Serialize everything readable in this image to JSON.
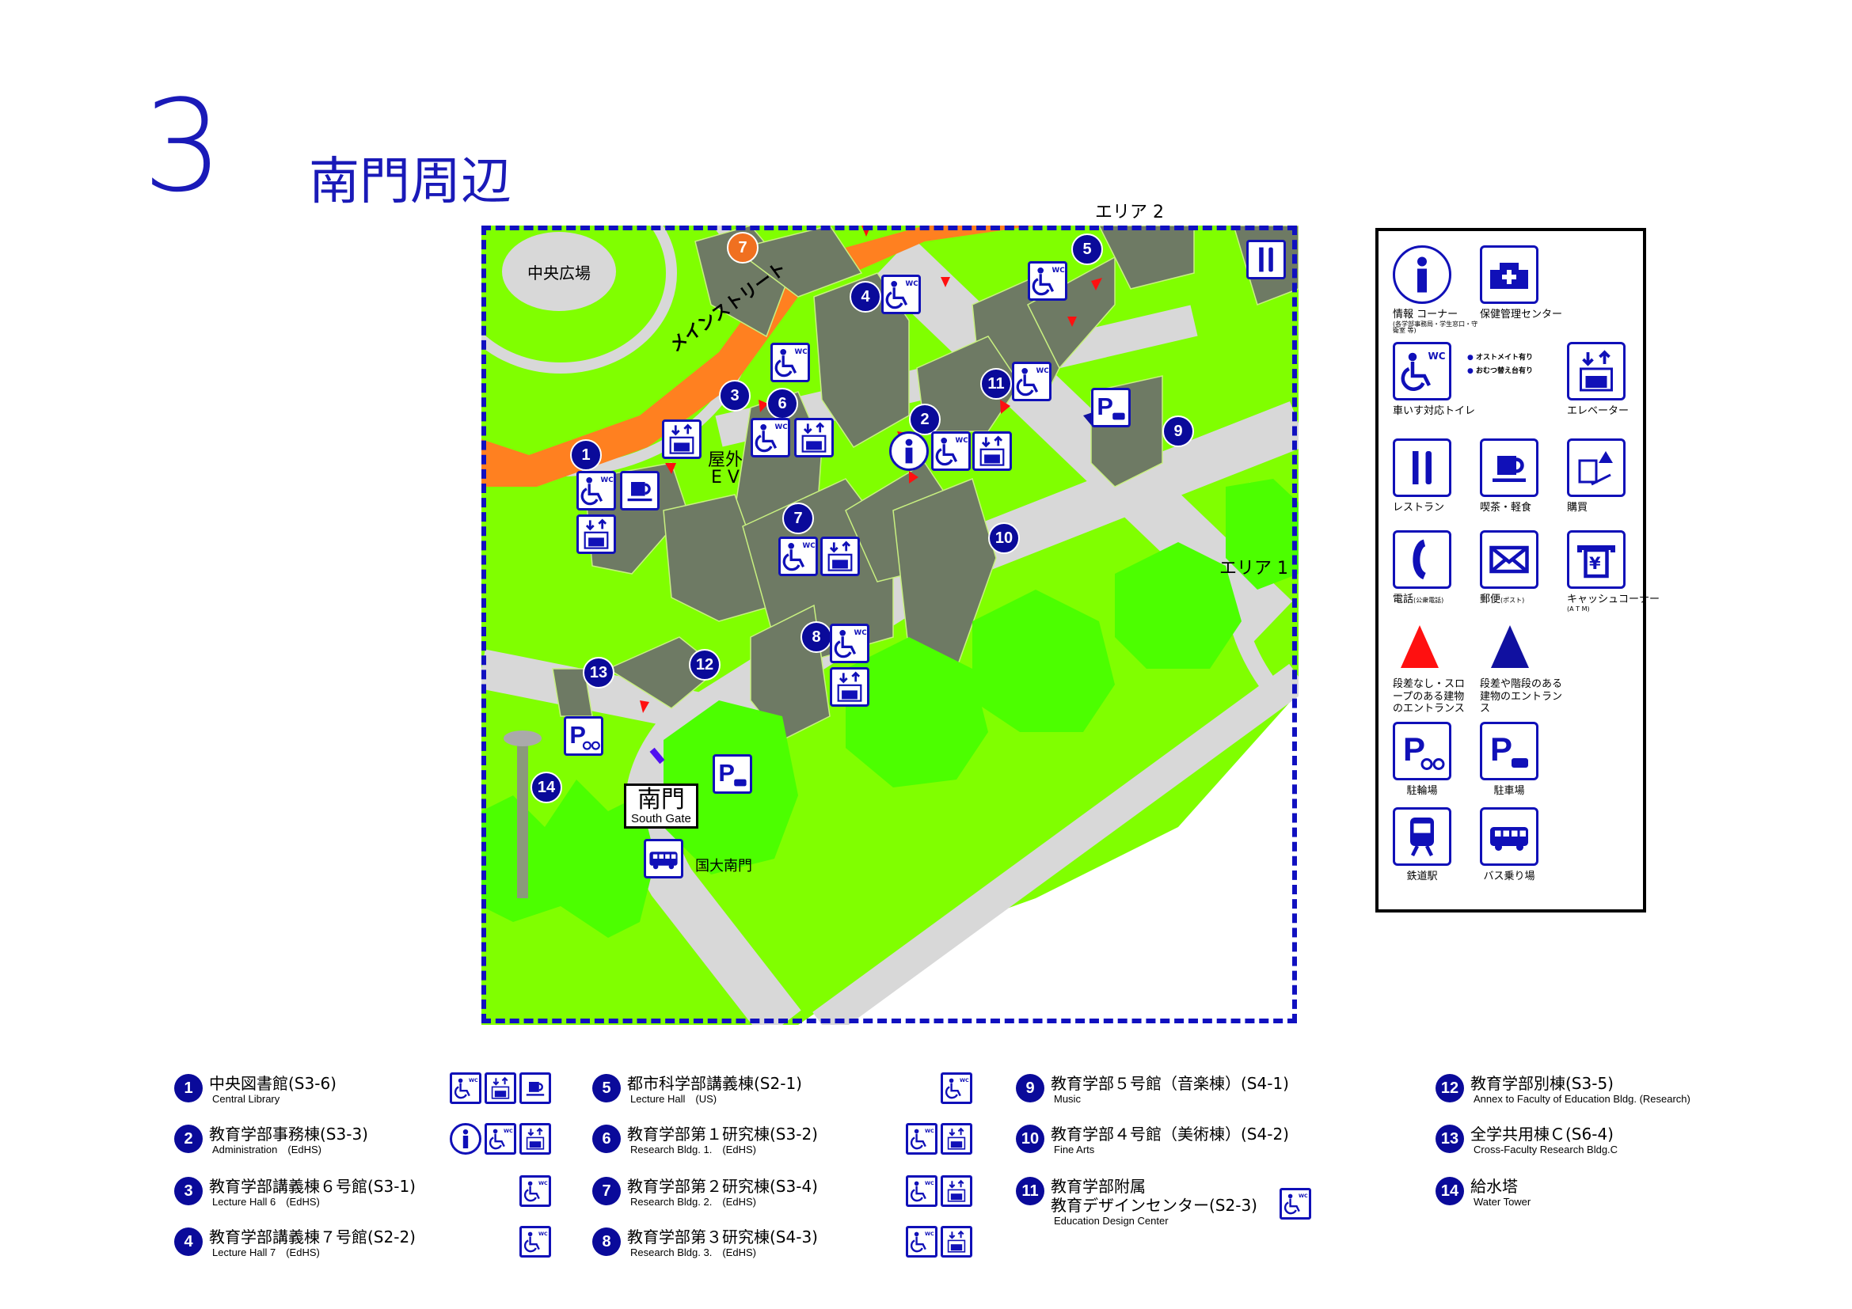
{
  "header": {
    "page_number": "3",
    "title": "南門周辺"
  },
  "map": {
    "area_labels": {
      "area2": "エリア 2",
      "area1": "エリア 1"
    },
    "place_labels": {
      "central_plaza": "中央広場",
      "main_street": "メインストリート",
      "outdoor_ev_line1": "屋外",
      "outdoor_ev_line2": "E V",
      "bus_stop": "国大南門"
    },
    "south_gate": {
      "jp": "南門",
      "en": "South Gate"
    },
    "building_markers": [
      "1",
      "2",
      "3",
      "4",
      "5",
      "6",
      "7",
      "8",
      "9",
      "10",
      "11",
      "12",
      "13",
      "14"
    ],
    "area_marker": "7",
    "colors": {
      "grass": "#80ff00",
      "tree": "#4cff00",
      "road": "#d8d8d8",
      "main_street": "#ff8020",
      "building": "#6e7a64",
      "border": "#1010c0",
      "pictogram": "#1010b8",
      "accessible_entrance": "#ff1010",
      "stepped_entrance": "#1010a0"
    }
  },
  "legend": {
    "items": [
      {
        "icon": "info-icon",
        "label": "情報 コーナー",
        "sub": "(各学部事務局・学生窓口・守衛室 等)"
      },
      {
        "icon": "health-center-icon",
        "label": "保健管理センター",
        "sub": ""
      },
      {
        "icon": "accessible-toilet-icon",
        "label": "車いす対応トイレ",
        "sub": ""
      },
      {
        "icon": "elevator-icon",
        "label": "エレベーター",
        "sub": ""
      },
      {
        "icon": "restaurant-icon",
        "label": "レストラン",
        "sub": ""
      },
      {
        "icon": "cafe-icon",
        "label": "喫茶・軽食",
        "sub": ""
      },
      {
        "icon": "shop-icon",
        "label": "購買",
        "sub": ""
      },
      {
        "icon": "phone-icon",
        "label": "電話",
        "sub": "(公衆電話)"
      },
      {
        "icon": "mail-icon",
        "label": "郵便",
        "sub": "(ポスト)"
      },
      {
        "icon": "atm-icon",
        "label": "キャッシュコーナー",
        "sub": "(A T M)"
      },
      {
        "icon": "red-triangle-icon",
        "label": "段差なし・スロープのある建物のエントランス",
        "sub": ""
      },
      {
        "icon": "blue-triangle-icon",
        "label": "段差や階段のある建物のエントランス",
        "sub": ""
      },
      {
        "icon": "bicycle-parking-icon",
        "label": "駐輪場",
        "sub": ""
      },
      {
        "icon": "car-parking-icon",
        "label": "駐車場",
        "sub": ""
      },
      {
        "icon": "train-icon",
        "label": "鉄道駅",
        "sub": ""
      },
      {
        "icon": "bus-icon",
        "label": "バス乗り場",
        "sub": ""
      }
    ],
    "ostomate": "オストメイト有り",
    "diaper": "おむつ替え台有り"
  },
  "buildings": [
    {
      "num": "1",
      "jp": "中央図書館",
      "code": "(S3-6)",
      "en": "Central Library",
      "icons": [
        "accessible-toilet-icon",
        "elevator-icon",
        "cafe-icon"
      ]
    },
    {
      "num": "2",
      "jp": "教育学部事務棟",
      "code": "(S3-3)",
      "en": "Administration　(EdHS)",
      "icons": [
        "info-icon",
        "accessible-toilet-icon",
        "elevator-icon"
      ]
    },
    {
      "num": "3",
      "jp": "教育学部講義棟６号館",
      "code": "(S3-1)",
      "en": "Lecture Hall 6　(EdHS)",
      "icons": [
        "accessible-toilet-icon"
      ]
    },
    {
      "num": "4",
      "jp": "教育学部講義棟７号館",
      "code": "(S2-2)",
      "en": "Lecture Hall 7　(EdHS)",
      "icons": [
        "accessible-toilet-icon"
      ]
    },
    {
      "num": "5",
      "jp": "都市科学部講義棟",
      "code": "(S2-1)",
      "en": "Lecture Hall　(US)",
      "icons": [
        "accessible-toilet-icon"
      ]
    },
    {
      "num": "6",
      "jp": "教育学部第１研究棟",
      "code": "(S3-2)",
      "en": "Research Bldg. 1.　(EdHS)",
      "icons": [
        "accessible-toilet-icon",
        "elevator-icon"
      ]
    },
    {
      "num": "7",
      "jp": "教育学部第２研究棟",
      "code": "(S3-4)",
      "en": "Research Bldg. 2.　(EdHS)",
      "icons": [
        "accessible-toilet-icon",
        "elevator-icon"
      ]
    },
    {
      "num": "8",
      "jp": "教育学部第３研究棟",
      "code": "(S4-3)",
      "en": "Research Bldg. 3.　(EdHS)",
      "icons": [
        "accessible-toilet-icon",
        "elevator-icon"
      ]
    },
    {
      "num": "9",
      "jp": "教育学部５号館（音楽棟）",
      "code": "(S4-1)",
      "en": "Music",
      "icons": []
    },
    {
      "num": "10",
      "jp": "教育学部４号館（美術棟）",
      "code": "(S4-2)",
      "en": "Fine Arts",
      "icons": []
    },
    {
      "num": "11",
      "jp": "教育学部附属",
      "jp2": "教育デザインセンター",
      "code": "(S2-3)",
      "en": "Education Design Center",
      "icons": [
        "accessible-toilet-icon"
      ]
    },
    {
      "num": "12",
      "jp": "教育学部別棟",
      "code": "(S3-5)",
      "en": "Annex to Faculty of Education Bldg. (Research)",
      "icons": []
    },
    {
      "num": "13",
      "jp": "全学共用棟Ｃ",
      "code": "(S6-4)",
      "en": "Cross-Faculty Research Bldg.C",
      "icons": []
    },
    {
      "num": "14",
      "jp": "給水塔",
      "code": "",
      "en": "Water Tower",
      "icons": []
    }
  ]
}
